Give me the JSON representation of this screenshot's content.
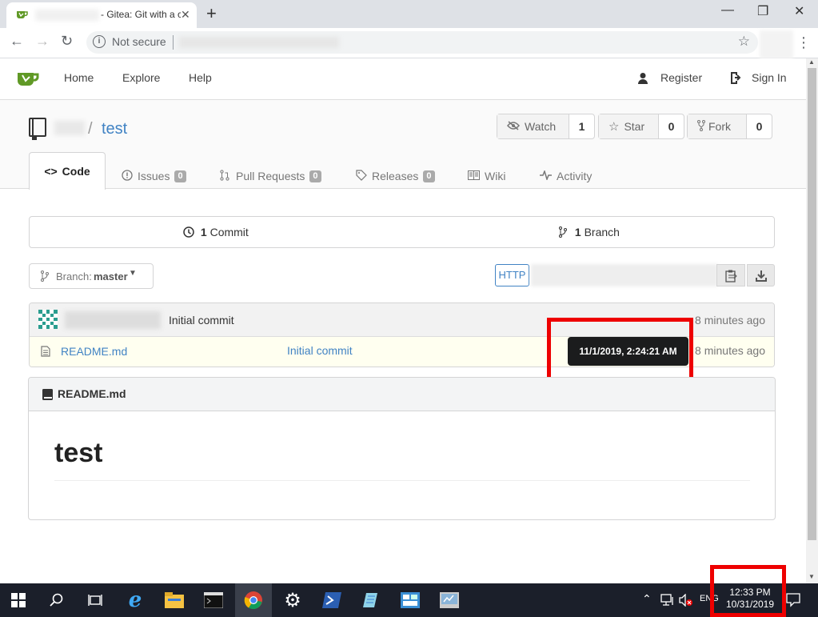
{
  "browser": {
    "tab_title": "- Gitea: Git with a c",
    "new_tab": "+",
    "security_label": "Not secure",
    "window_controls": {
      "minimize": "—",
      "restore": "❐",
      "close": "✕"
    }
  },
  "nav": {
    "home": "Home",
    "explore": "Explore",
    "help": "Help",
    "register": "Register",
    "sign_in": "Sign In"
  },
  "repo": {
    "separator": "/",
    "name": "test",
    "watch_label": "Watch",
    "watch_count": "1",
    "star_label": "Star",
    "star_count": "0",
    "fork_label": "Fork",
    "fork_count": "0"
  },
  "tabs": {
    "code": "Code",
    "issues": "Issues",
    "issues_count": "0",
    "pulls": "Pull Requests",
    "pulls_count": "0",
    "releases": "Releases",
    "releases_count": "0",
    "wiki": "Wiki",
    "activity": "Activity"
  },
  "stats": {
    "commits_num": "1",
    "commits_label": "Commit",
    "branches_num": "1",
    "branches_label": "Branch"
  },
  "branch": {
    "label": "Branch:",
    "value": "master"
  },
  "clone": {
    "protocol": "HTTP"
  },
  "latest_commit": {
    "message": "Initial commit",
    "age": "8 minutes ago"
  },
  "files": [
    {
      "name": "README.md",
      "commit": "Initial commit",
      "age": "8 minutes ago"
    }
  ],
  "tooltip": "11/1/2019, 2:24:21 AM",
  "readme": {
    "filename": "README.md",
    "heading": "test"
  },
  "taskbar": {
    "time": "12:33 PM",
    "date": "10/31/2019",
    "language": "ENG"
  },
  "colors": {
    "link": "#4183c4",
    "gitea_green": "#609926",
    "highlight_red": "#e00000",
    "taskbar": "#1b1f2a"
  }
}
